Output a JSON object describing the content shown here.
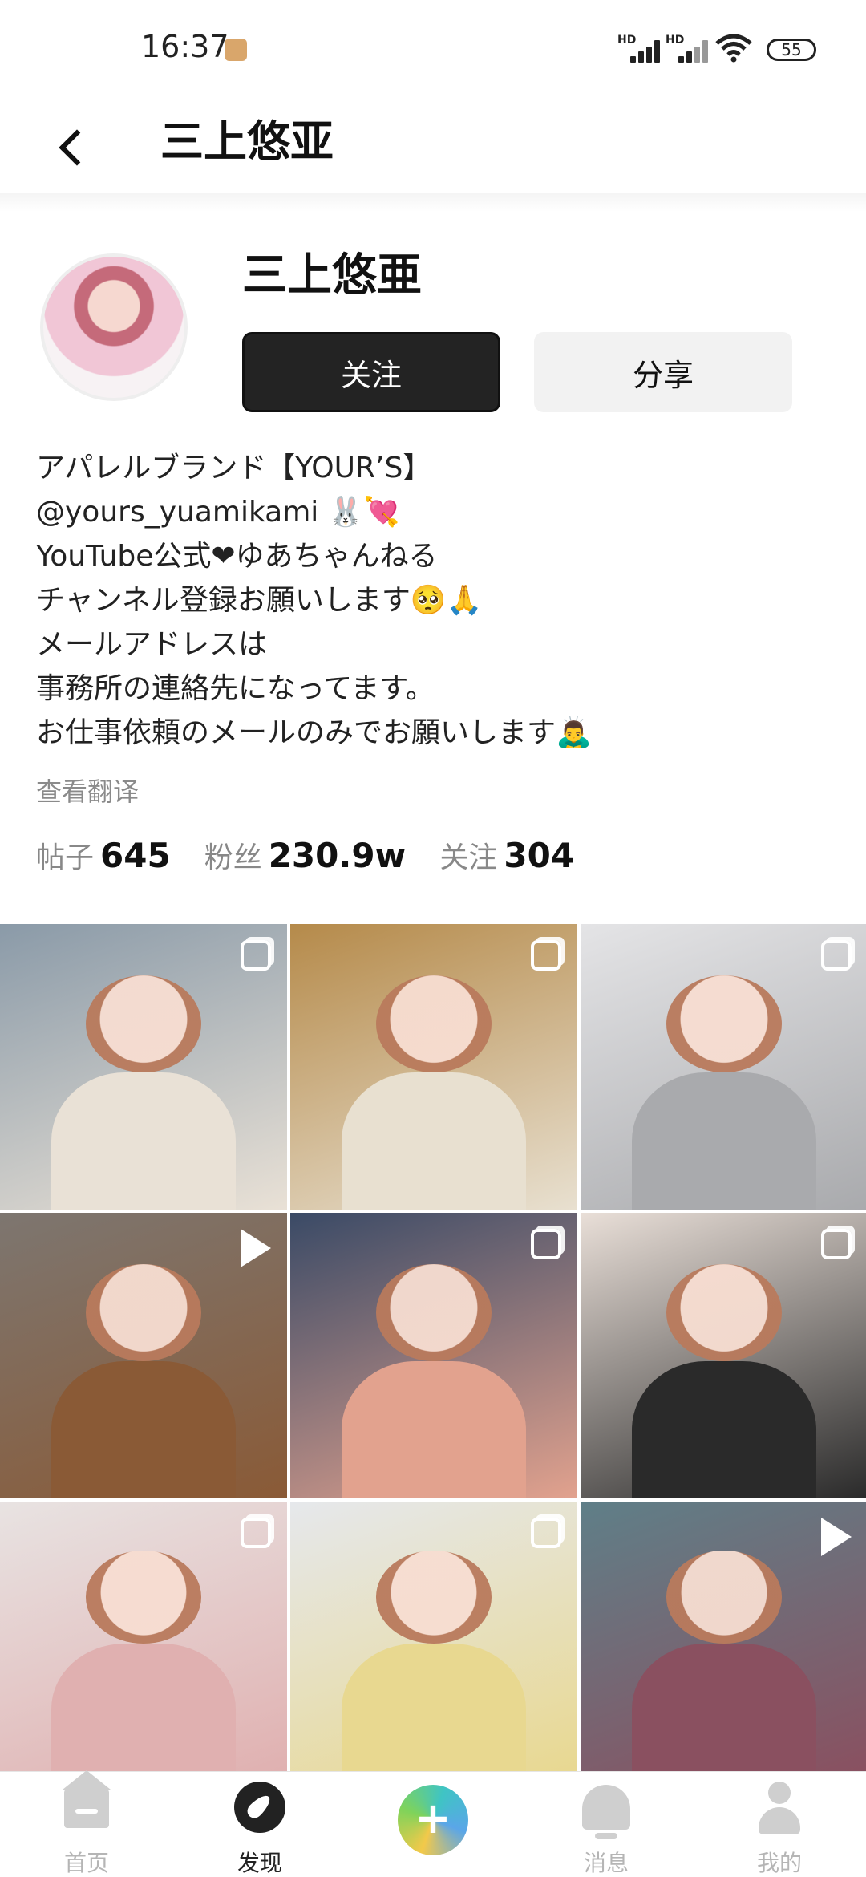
{
  "status_bar": {
    "time": "16:37",
    "signal1_label": "HD",
    "signal2_label": "HD",
    "battery": "55"
  },
  "header": {
    "title": "三上悠亚"
  },
  "profile": {
    "name": "三上悠亜",
    "follow_label": "关注",
    "share_label": "分享",
    "bio_lines": [
      "アパレルブランド【YOUR’S】",
      "@yours_yuamikami 🐰💘",
      "YouTube公式❤ゆあちゃんねる",
      "チャンネル登録お願いします🥺🙏",
      "メールアドレスは",
      "事務所の連絡先になってます。",
      "お仕事依頼のメールのみでお願いします🙇‍♂️"
    ],
    "translate_label": "查看翻译",
    "stats": {
      "posts_label": "帖子",
      "posts_value": "645",
      "fans_label": "粉丝",
      "fans_value": "230.9w",
      "following_label": "关注",
      "following_value": "304"
    }
  },
  "grid": {
    "posts": [
      {
        "type": "multi",
        "bg": "#8a9aa8",
        "accent": "#e9e1d6"
      },
      {
        "type": "multi",
        "bg": "#b58a4a",
        "accent": "#e8e0d0"
      },
      {
        "type": "multi",
        "bg": "#e4e4e6",
        "accent": "#a9aaad"
      },
      {
        "type": "video",
        "bg": "#7d7670",
        "accent": "#8a5a36"
      },
      {
        "type": "multi",
        "bg": "#3a4a66",
        "accent": "#e2a28e"
      },
      {
        "type": "multi",
        "bg": "#e9dfd8",
        "accent": "#2a2a2a"
      },
      {
        "type": "multi",
        "bg": "#e8e3e2",
        "accent": "#e0b0b0"
      },
      {
        "type": "multi",
        "bg": "#e6e8ec",
        "accent": "#e8d890"
      },
      {
        "type": "video",
        "bg": "#5f7f88",
        "accent": "#8a5060"
      }
    ]
  },
  "nav": {
    "items": [
      {
        "label": "首页",
        "icon": "home-icon"
      },
      {
        "label": "发现",
        "icon": "discover-icon"
      },
      {
        "label": "消息",
        "icon": "bell-icon"
      },
      {
        "label": "我的",
        "icon": "user-icon"
      }
    ],
    "add_symbol": "+"
  }
}
